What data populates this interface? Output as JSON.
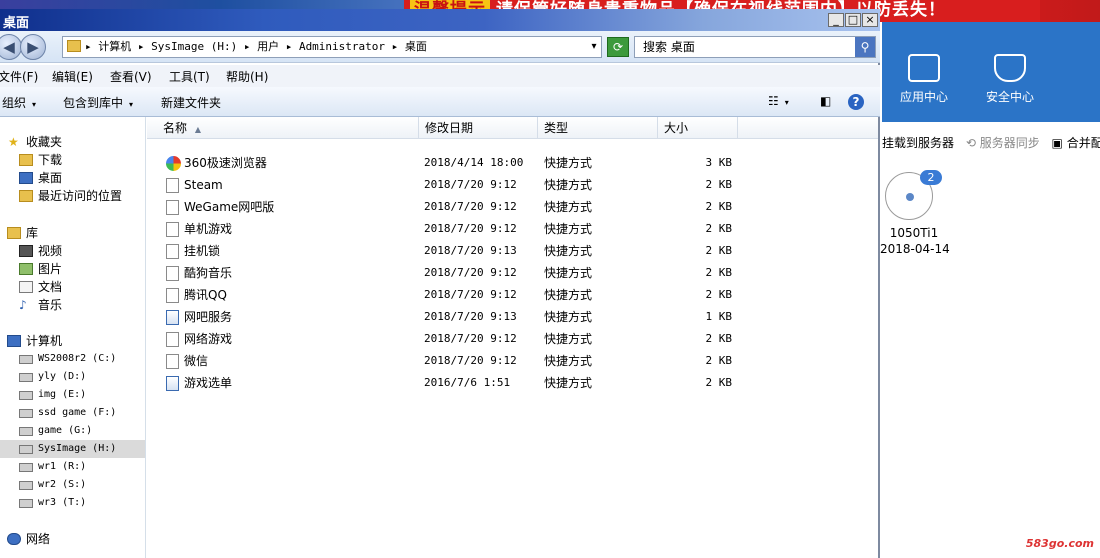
{
  "banner": {
    "text_tag": "温馨提示",
    "text": "请保管好随身贵重物品【确保在视线范围内】以防丢失！"
  },
  "window": {
    "title": "桌面",
    "min": "_",
    "max": "□",
    "close": "×"
  },
  "address": {
    "back": "◀",
    "forward": "▶",
    "path": "▸ 计算机 ▸ SysImage (H:) ▸ 用户 ▸ Administrator ▸ 桌面",
    "dropdown": "▾",
    "refresh": "⟳",
    "search_placeholder": "搜索 桌面",
    "search_icon": "⚲"
  },
  "menu": [
    "文件(F)",
    "编辑(E)",
    "查看(V)",
    "工具(T)",
    "帮助(H)"
  ],
  "toolbar": {
    "organize": "组织",
    "include": "包含到库中",
    "new_folder": "新建文件夹",
    "caret": "▾",
    "view_icon": "☷",
    "pane_icon": "◧",
    "help_icon": "?"
  },
  "nav": {
    "favorites": "收藏夹",
    "downloads": "下载",
    "desktop": "桌面",
    "recent": "最近访问的位置",
    "libraries": "库",
    "videos": "视频",
    "pictures": "图片",
    "documents": "文档",
    "music": "音乐",
    "computer": "计算机",
    "drives": [
      "WS2008r2 (C:)",
      "yly (D:)",
      "img (E:)",
      "ssd game (F:)",
      "game (G:)",
      "SysImage (H:)",
      "wr1 (R:)",
      "wr2 (S:)",
      "wr3 (T:)"
    ],
    "network": "网络"
  },
  "columns": {
    "name": "名称",
    "sort": "▲",
    "date": "修改日期",
    "type": "类型",
    "size": "大小"
  },
  "files": [
    {
      "name": "360极速浏览器",
      "date": "2018/4/14 18:00",
      "type": "快捷方式",
      "size": "3 KB",
      "icon": "browser"
    },
    {
      "name": "Steam",
      "date": "2018/7/20 9:12",
      "type": "快捷方式",
      "size": "2 KB",
      "icon": "file"
    },
    {
      "name": "WeGame网吧版",
      "date": "2018/7/20 9:12",
      "type": "快捷方式",
      "size": "2 KB",
      "icon": "file"
    },
    {
      "name": "单机游戏",
      "date": "2018/7/20 9:12",
      "type": "快捷方式",
      "size": "2 KB",
      "icon": "file"
    },
    {
      "name": "挂机锁",
      "date": "2018/7/20 9:13",
      "type": "快捷方式",
      "size": "2 KB",
      "icon": "file"
    },
    {
      "name": "酷狗音乐",
      "date": "2018/7/20 9:12",
      "type": "快捷方式",
      "size": "2 KB",
      "icon": "file"
    },
    {
      "name": "腾讯QQ",
      "date": "2018/7/20 9:12",
      "type": "快捷方式",
      "size": "2 KB",
      "icon": "file"
    },
    {
      "name": "网吧服务",
      "date": "2018/7/20 9:13",
      "type": "快捷方式",
      "size": "1 KB",
      "icon": "app"
    },
    {
      "name": "网络游戏",
      "date": "2018/7/20 9:12",
      "type": "快捷方式",
      "size": "2 KB",
      "icon": "file"
    },
    {
      "name": "微信",
      "date": "2018/7/20 9:12",
      "type": "快捷方式",
      "size": "2 KB",
      "icon": "file"
    },
    {
      "name": "游戏选单",
      "date": "2016/7/6 1:51",
      "type": "快捷方式",
      "size": "2 KB",
      "icon": "app"
    }
  ],
  "right_app": {
    "app_center": "应用中心",
    "security_center": "安全中心",
    "mount": "挂载到服务器",
    "sync": "⟲ 服务器同步",
    "merge": "▣ 合并配置",
    "disk_badge": "2",
    "disk_label": "1050Ti1",
    "disk_date": "2018-04-14",
    "watermark": "583go.com"
  }
}
